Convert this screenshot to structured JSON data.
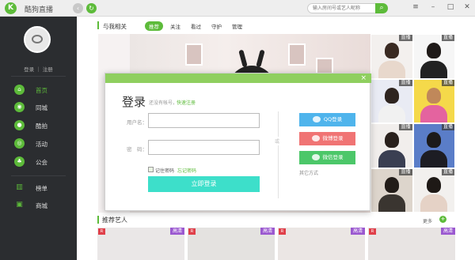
{
  "app": {
    "name": "酷狗直播"
  },
  "search": {
    "placeholder": "输入房间号或艺人昵称"
  },
  "sidebar": {
    "login_links": "登录 ｜ 注册",
    "items": [
      {
        "label": "首页",
        "icon": "home-icon"
      },
      {
        "label": "同城",
        "icon": "location-icon"
      },
      {
        "label": "酷拍",
        "icon": "camera-icon"
      },
      {
        "label": "活动",
        "icon": "activity-icon"
      },
      {
        "label": "公会",
        "icon": "guild-icon"
      },
      {
        "label": "榜单",
        "icon": "ranking-icon"
      },
      {
        "label": "商城",
        "icon": "shop-icon"
      }
    ]
  },
  "main": {
    "section_title": "与我相关",
    "tabs": [
      "推荐",
      "关注",
      "看过",
      "守护",
      "管理"
    ],
    "thumb_tag": "直播",
    "recommend_title": "推荐艺人",
    "more": "更多",
    "card_badge": "高清"
  },
  "modal": {
    "title": "登录",
    "no_account": "还没有帐号，",
    "quick_register": "快速注册",
    "username_label": "用户名：",
    "password_label": "密　码：",
    "remember": "记住密码",
    "forgot": "忘记密码",
    "login_button": "立即登录",
    "or": "或",
    "qq": "QQ登录",
    "weibo": "微博登录",
    "wechat": "微信登录",
    "other": "其它方式",
    "close": "×"
  },
  "colors": {
    "accent": "#5dbb3a",
    "login_button": "#3ddfca",
    "qq": "#4fb4ec",
    "weibo": "#f07474",
    "wechat": "#4cc769"
  }
}
